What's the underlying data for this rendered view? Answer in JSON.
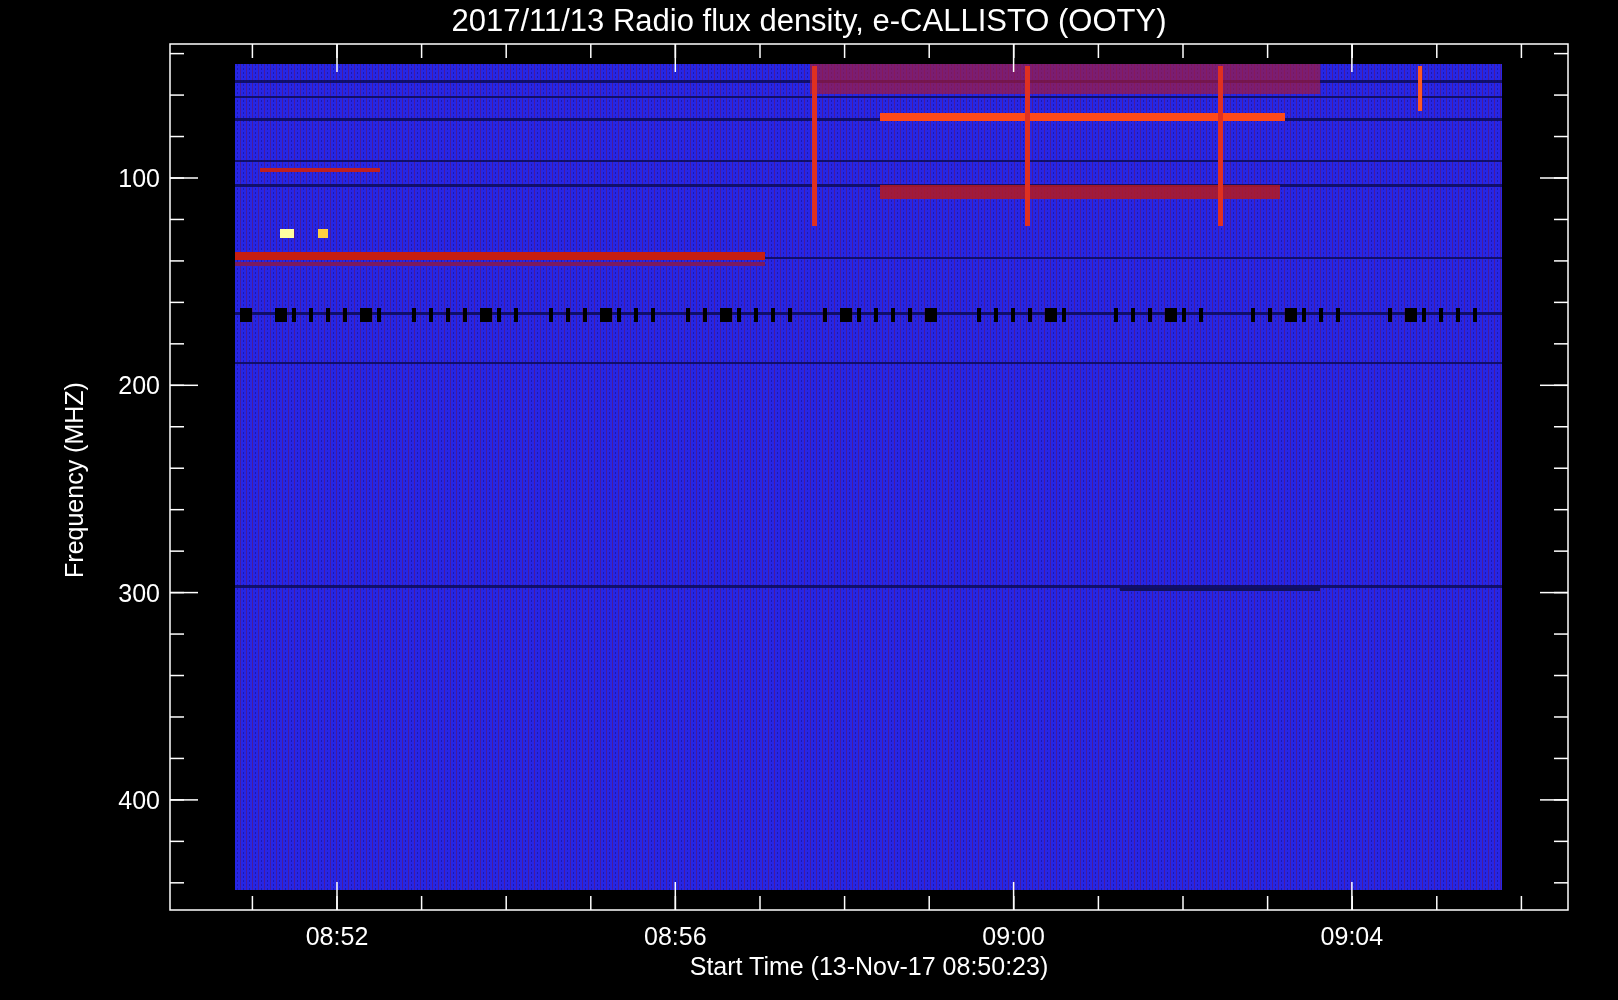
{
  "title": "2017/11/13  Radio flux density, e-CALLISTO (OOTY)",
  "y_axis": {
    "label": "Frequency (MHZ)",
    "ticks": [
      "100",
      "200",
      "300",
      "400"
    ]
  },
  "x_axis": {
    "label": "Start Time (13-Nov-17 08:50:23)",
    "ticks": [
      "08:52",
      "08:56",
      "09:00",
      "09:04"
    ]
  }
}
